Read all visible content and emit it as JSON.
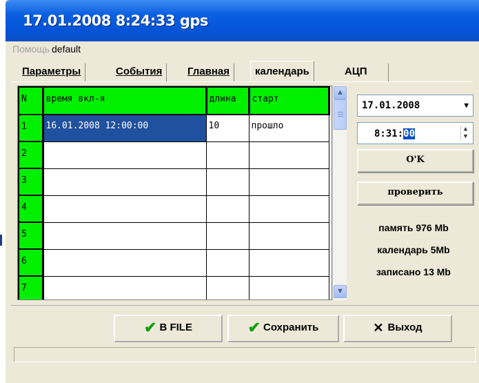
{
  "window": {
    "title": "17.01.2008 8:24:33  gps"
  },
  "menu": {
    "help": "Помощь",
    "default": "default"
  },
  "tabs": [
    {
      "label": "Параметры"
    },
    {
      "label": "События"
    },
    {
      "label": "Главная"
    },
    {
      "label": "календарь"
    },
    {
      "label": "АЦП"
    }
  ],
  "grid": {
    "headers": {
      "num": "N",
      "time": "время вкл-я",
      "length": "длина",
      "start": "старт"
    },
    "rows": [
      {
        "num": "1",
        "time": "16.01.2008 12:00:00",
        "length": "10",
        "start": "прошло"
      },
      {
        "num": "2",
        "time": "",
        "length": "",
        "start": ""
      },
      {
        "num": "3",
        "time": "",
        "length": "",
        "start": ""
      },
      {
        "num": "4",
        "time": "",
        "length": "",
        "start": ""
      },
      {
        "num": "5",
        "time": "",
        "length": "",
        "start": ""
      },
      {
        "num": "6",
        "time": "",
        "length": "",
        "start": ""
      },
      {
        "num": "7",
        "time": "",
        "length": "",
        "start": ""
      }
    ]
  },
  "side": {
    "date_value": "17.01.2008",
    "time_prefix": "8:31:",
    "time_selected": "00",
    "ok_label": "O'K",
    "check_label": "проверить",
    "memory": "память 976 Mb",
    "calendar": "календарь 5Mb",
    "written": "записано 13 Mb"
  },
  "buttons": {
    "file": "В FILE",
    "save": "Сохранить",
    "exit": "Выход"
  },
  "colors": {
    "grid_header": "#00f000",
    "selection": "#20519f",
    "titlebar": "#0555d8"
  }
}
